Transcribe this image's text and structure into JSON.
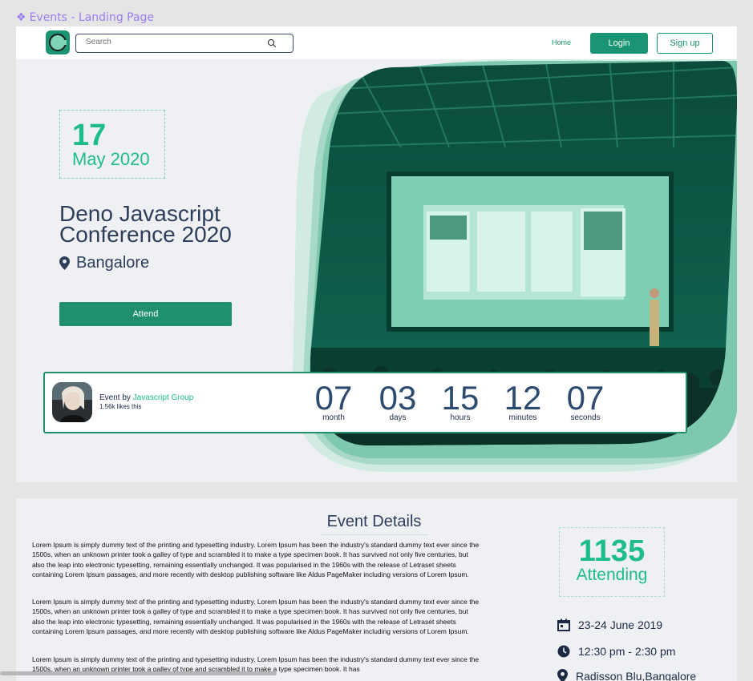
{
  "frame": {
    "label": "Events - Landing Page"
  },
  "navbar": {
    "search_placeholder": "Search",
    "home_link": "Home",
    "login_label": "Login",
    "signup_label": "Sign up"
  },
  "event": {
    "day": "17",
    "month_year": "May 2020",
    "title": "Deno Javascript Conference 2020",
    "location": "Bangalore",
    "attend_label": "Attend"
  },
  "organizer": {
    "prefix": "Event  by",
    "name": "Javascript Group",
    "likes": "1.56k likes this"
  },
  "countdown": [
    {
      "value": "07",
      "unit": "month"
    },
    {
      "value": "03",
      "unit": "days"
    },
    {
      "value": "15",
      "unit": "hours"
    },
    {
      "value": "12",
      "unit": "minutes"
    },
    {
      "value": "07",
      "unit": "seconds"
    }
  ],
  "details": {
    "heading": "Event Details",
    "paragraphs": [
      "Lorem Ipsum is simply dummy text of the printing and typesetting industry. Lorem Ipsum has been the industry's standard dummy text ever since the 1500s, when an unknown printer took a galley of type and scrambled it to make a type specimen book. It has survived not only five centuries, but also the leap into electronic typesetting, remaining essentially unchanged. It was popularised in the 1960s with the release of Letraset sheets containing Lorem Ipsum passages, and more recently with desktop publishing software like Aldus PageMaker including versions of Lorem Ipsum.",
      "Lorem Ipsum is simply dummy text of the printing and typesetting industry. Lorem Ipsum has been the industry's standard dummy text ever since the 1500s, when an unknown printer took a galley of type and scrambled it to make a type specimen book. It has survived not only five centuries, but also the leap into electronic typesetting, remaining essentially unchanged. It was popularised in the 1960s with the release of Letraset sheets containing Lorem Ipsum passages, and more recently with desktop publishing software like Aldus PageMaker including versions of Lorem Ipsum.",
      "Lorem Ipsum is simply dummy text of the printing and typesetting industry. Lorem Ipsum has been the industry's standard dummy text ever since the 1500s, when an unknown printer took a galley of type and scrambled it to make a type specimen book. It has"
    ],
    "attending_count": "1135",
    "attending_label": "Attending",
    "date": "23-24 June 2019",
    "time": "12:30 pm - 2:30 pm",
    "venue": "Radisson Blu,Bangalore"
  },
  "icons": {
    "frame": "diamond-icon",
    "logo": "logo-icon",
    "search": "search-icon",
    "location": "location-pin-icon",
    "calendar": "calendar-icon",
    "clock": "clock-icon"
  },
  "colors": {
    "accent": "#1a9472",
    "accent_light": "#1ebc8c",
    "heading": "#2d3d5a",
    "frame_label": "#9b7cf0"
  }
}
